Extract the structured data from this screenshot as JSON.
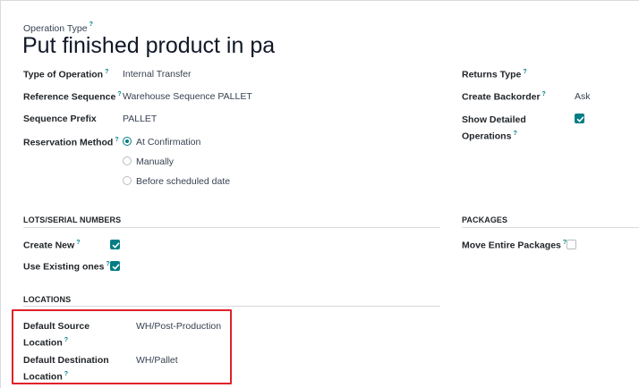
{
  "header": {
    "operation_type_label": "Operation Type",
    "title": "Put finished product in pa"
  },
  "fields": {
    "type_of_operation": {
      "label": "Type of Operation",
      "value": "Internal Transfer"
    },
    "reference_sequence": {
      "label": "Reference Sequence",
      "value": "Warehouse Sequence PALLET"
    },
    "sequence_prefix": {
      "label": "Sequence Prefix",
      "value": "PALLET"
    },
    "reservation_method": {
      "label": "Reservation Method",
      "options": [
        "At Confirmation",
        "Manually",
        "Before scheduled date"
      ],
      "selected": "At Confirmation"
    },
    "returns_type": {
      "label": "Returns Type",
      "value": ""
    },
    "create_backorder": {
      "label": "Create Backorder",
      "value": "Ask"
    },
    "show_detailed_operations": {
      "label_line1": "Show Detailed",
      "label_line2": "Operations",
      "checked": true
    }
  },
  "lots_section": {
    "title": "LOTS/SERIAL NUMBERS",
    "create_new": {
      "label": "Create New",
      "checked": true
    },
    "use_existing": {
      "label": "Use Existing ones",
      "checked": true
    }
  },
  "packages_section": {
    "title": "PACKAGES",
    "move_entire_packages": {
      "label": "Move Entire Packages",
      "checked": false
    }
  },
  "locations_section": {
    "title": "LOCATIONS",
    "default_source": {
      "label_line1": "Default Source",
      "label_line2": "Location",
      "value": "WH/Post-Production"
    },
    "default_destination": {
      "label_line1": "Default Destination",
      "label_line2": "Location",
      "value": "WH/Pallet"
    }
  },
  "help_marker": "?",
  "colors": {
    "accent": "#017e84",
    "highlight_box": "#e0212a"
  }
}
